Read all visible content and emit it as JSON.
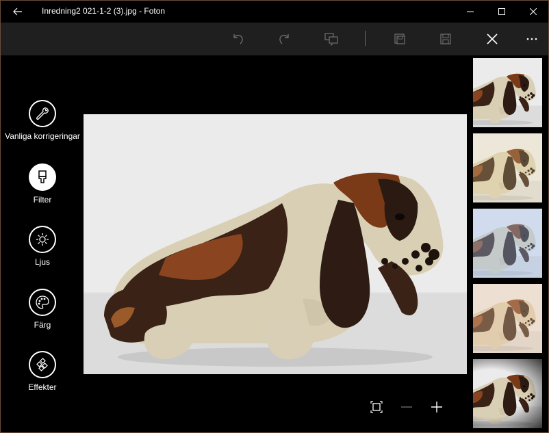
{
  "window": {
    "title": "Inredning2 021-1-2 (3).jpg - Foton",
    "border_color": "#6b4a3a"
  },
  "titlebar": {
    "back_icon": "arrow-left-icon",
    "controls": [
      "minimize-icon",
      "maximize-icon",
      "close-icon"
    ]
  },
  "toolbar": {
    "icons": [
      "undo-icon",
      "redo-icon",
      "compare-icon",
      "save-copy-icon",
      "save-icon",
      "close-icon",
      "more-icon"
    ]
  },
  "edit_tools": [
    {
      "label": "Vanliga korrigeringar",
      "icon": "wrench-icon",
      "active": false
    },
    {
      "label": "Filter",
      "icon": "paintbrush-icon",
      "active": true
    },
    {
      "label": "Ljus",
      "icon": "sun-icon",
      "active": false
    },
    {
      "label": "Färg",
      "icon": "palette-icon",
      "active": false
    },
    {
      "label": "Effekter",
      "icon": "effects-icon",
      "active": false
    }
  ],
  "image": {
    "subject": "ceramic basset hound figurine",
    "background_color": "#e4e4e4"
  },
  "filters": [
    {
      "tint": "#ffffff"
    },
    {
      "tint": "#f2e6c8"
    },
    {
      "tint": "#c9d9f0"
    },
    {
      "tint": "#f4d9c0"
    },
    {
      "tint": "#808080"
    }
  ],
  "zoom": {
    "icons": [
      "fit-to-screen-icon",
      "zoom-out-icon",
      "zoom-in-icon"
    ]
  },
  "colors": {
    "background": "#000000",
    "toolbar": "#1f1f1f",
    "text": "#ffffff",
    "disabled_icon": "#6a6a6a"
  }
}
